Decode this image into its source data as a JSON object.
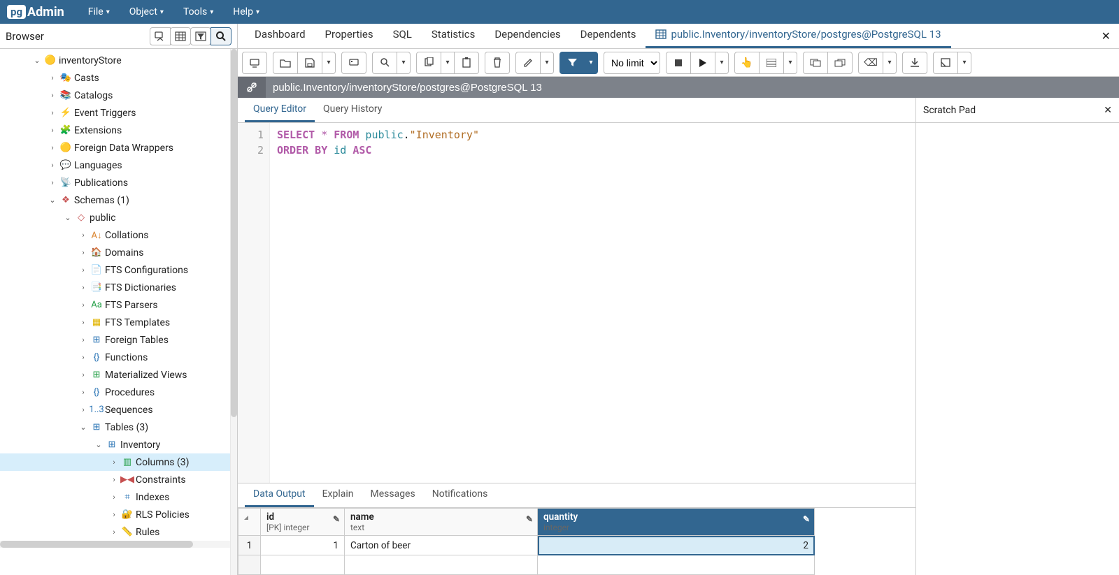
{
  "menubar": {
    "logo_pg": "pg",
    "logo_admin": "Admin",
    "items": [
      "File",
      "Object",
      "Tools",
      "Help"
    ]
  },
  "browser": {
    "title": "Browser",
    "tree": [
      {
        "level": 2,
        "expanded": true,
        "collapsible": true,
        "icon": "🟡",
        "iconClass": "yellow-ico",
        "label": "inventoryStore"
      },
      {
        "level": 3,
        "expanded": false,
        "collapsible": true,
        "icon": "🎭",
        "iconClass": "blue-ico",
        "label": "Casts"
      },
      {
        "level": 3,
        "expanded": false,
        "collapsible": true,
        "icon": "📚",
        "iconClass": "blue-ico",
        "label": "Catalogs"
      },
      {
        "level": 3,
        "expanded": false,
        "collapsible": true,
        "icon": "⚡",
        "iconClass": "blue-ico",
        "label": "Event Triggers"
      },
      {
        "level": 3,
        "expanded": false,
        "collapsible": true,
        "icon": "🧩",
        "iconClass": "green-ico",
        "label": "Extensions"
      },
      {
        "level": 3,
        "expanded": false,
        "collapsible": true,
        "icon": "🟡",
        "iconClass": "yellow-ico",
        "label": "Foreign Data Wrappers"
      },
      {
        "level": 3,
        "expanded": false,
        "collapsible": true,
        "icon": "💬",
        "iconClass": "yellow-ico",
        "label": "Languages"
      },
      {
        "level": 3,
        "expanded": false,
        "collapsible": true,
        "icon": "📡",
        "iconClass": "blue-ico",
        "label": "Publications"
      },
      {
        "level": 3,
        "expanded": true,
        "collapsible": true,
        "icon": "❖",
        "iconClass": "red-ico",
        "label": "Schemas (1)"
      },
      {
        "level": 4,
        "expanded": true,
        "collapsible": true,
        "icon": "◇",
        "iconClass": "red-ico",
        "label": "public"
      },
      {
        "level": 5,
        "expanded": false,
        "collapsible": true,
        "icon": "A↓",
        "iconClass": "orange-ico",
        "label": "Collations"
      },
      {
        "level": 5,
        "expanded": false,
        "collapsible": true,
        "icon": "🏠",
        "iconClass": "orange-ico",
        "label": "Domains"
      },
      {
        "level": 5,
        "expanded": false,
        "collapsible": true,
        "icon": "📄",
        "iconClass": "",
        "label": "FTS Configurations"
      },
      {
        "level": 5,
        "expanded": false,
        "collapsible": true,
        "icon": "📑",
        "iconClass": "blue-ico",
        "label": "FTS Dictionaries"
      },
      {
        "level": 5,
        "expanded": false,
        "collapsible": true,
        "icon": "Aa",
        "iconClass": "green-ico",
        "label": "FTS Parsers"
      },
      {
        "level": 5,
        "expanded": false,
        "collapsible": true,
        "icon": "▦",
        "iconClass": "yellow-ico",
        "label": "FTS Templates"
      },
      {
        "level": 5,
        "expanded": false,
        "collapsible": true,
        "icon": "⊞",
        "iconClass": "blue-ico",
        "label": "Foreign Tables"
      },
      {
        "level": 5,
        "expanded": false,
        "collapsible": true,
        "icon": "{}",
        "iconClass": "blue-ico",
        "label": "Functions"
      },
      {
        "level": 5,
        "expanded": false,
        "collapsible": true,
        "icon": "⊞",
        "iconClass": "green-ico",
        "label": "Materialized Views"
      },
      {
        "level": 5,
        "expanded": false,
        "collapsible": true,
        "icon": "{}",
        "iconClass": "blue-ico",
        "label": "Procedures"
      },
      {
        "level": 5,
        "expanded": false,
        "collapsible": true,
        "icon": "1..3",
        "iconClass": "blue-ico",
        "label": "Sequences"
      },
      {
        "level": 5,
        "expanded": true,
        "collapsible": true,
        "icon": "⊞",
        "iconClass": "blue-ico",
        "label": "Tables (3)"
      },
      {
        "level": 6,
        "expanded": true,
        "collapsible": true,
        "icon": "⊞",
        "iconClass": "blue-ico",
        "label": "Inventory"
      },
      {
        "level": 7,
        "expanded": false,
        "collapsible": true,
        "icon": "▥",
        "iconClass": "green-ico",
        "label": "Columns (3)",
        "selected": true
      },
      {
        "level": 7,
        "expanded": false,
        "collapsible": true,
        "icon": "▶◀",
        "iconClass": "red-ico",
        "label": "Constraints"
      },
      {
        "level": 7,
        "expanded": false,
        "collapsible": true,
        "icon": "⌗",
        "iconClass": "blue-ico",
        "label": "Indexes"
      },
      {
        "level": 7,
        "expanded": false,
        "collapsible": true,
        "icon": "🔐",
        "iconClass": "green-ico",
        "label": "RLS Policies"
      },
      {
        "level": 7,
        "expanded": false,
        "collapsible": true,
        "icon": "📏",
        "iconClass": "yellow-ico",
        "label": "Rules"
      }
    ]
  },
  "main_tabs": {
    "items": [
      "Dashboard",
      "Properties",
      "SQL",
      "Statistics",
      "Dependencies",
      "Dependents"
    ],
    "active_title": "public.Inventory/inventoryStore/postgres@PostgreSQL 13"
  },
  "toolbar": {
    "limit": "No limit"
  },
  "pathbar": {
    "text": "public.Inventory/inventoryStore/postgres@PostgreSQL 13"
  },
  "editor": {
    "tabs": [
      "Query Editor",
      "Query History"
    ],
    "active_tab": 0,
    "line_numbers": [
      "1",
      "2"
    ],
    "line1": {
      "a": "SELECT",
      "b": " * ",
      "c": "FROM",
      "d": " public",
      "e": ".",
      "f": "\"Inventory\""
    },
    "line2": {
      "a": "ORDER BY",
      "b": " id ",
      "c": "ASC"
    }
  },
  "output": {
    "tabs": [
      "Data Output",
      "Explain",
      "Messages",
      "Notifications"
    ],
    "active_tab": 0,
    "columns": [
      {
        "name": "id",
        "type": "[PK] integer",
        "width": "col-id",
        "editable": true
      },
      {
        "name": "name",
        "type": "text",
        "width": "col-name",
        "editable": true
      },
      {
        "name": "quantity",
        "type": "integer",
        "width": "col-qty",
        "editable": true,
        "selected": true
      }
    ],
    "rows": [
      {
        "num": "1",
        "id": "1",
        "name": "Carton of beer",
        "quantity": "2"
      }
    ]
  },
  "scratch": {
    "title": "Scratch Pad"
  }
}
